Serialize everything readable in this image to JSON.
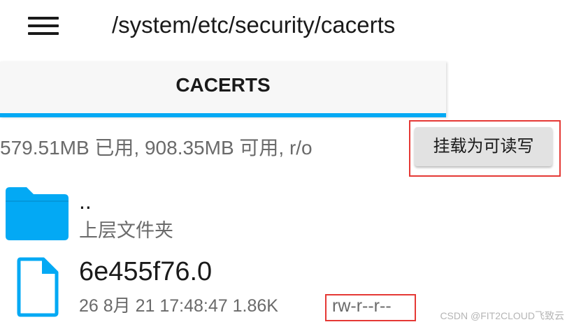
{
  "header": {
    "path": "/system/etc/security/cacerts"
  },
  "tabs": [
    {
      "label": "CACERTS",
      "active": true
    }
  ],
  "storage": {
    "info": "579.51MB 已用, 908.35MB 可用, r/o",
    "mount_button_label": "挂载为可读写"
  },
  "items": [
    {
      "name": "..",
      "subtitle": "上层文件夹",
      "icon": "folder-icon"
    },
    {
      "name": "6e455f76.0",
      "date": "26 8月 21 17:48:47",
      "size": "1.86K",
      "permissions": "rw-r--r--",
      "icon": "file-icon"
    }
  ],
  "watermark": "CSDN @FIT2CLOUD飞致云",
  "colors": {
    "accent": "#03a9f4",
    "highlight": "#e53935",
    "text_primary": "#1a1a1a",
    "text_secondary": "#6a6a6a"
  }
}
